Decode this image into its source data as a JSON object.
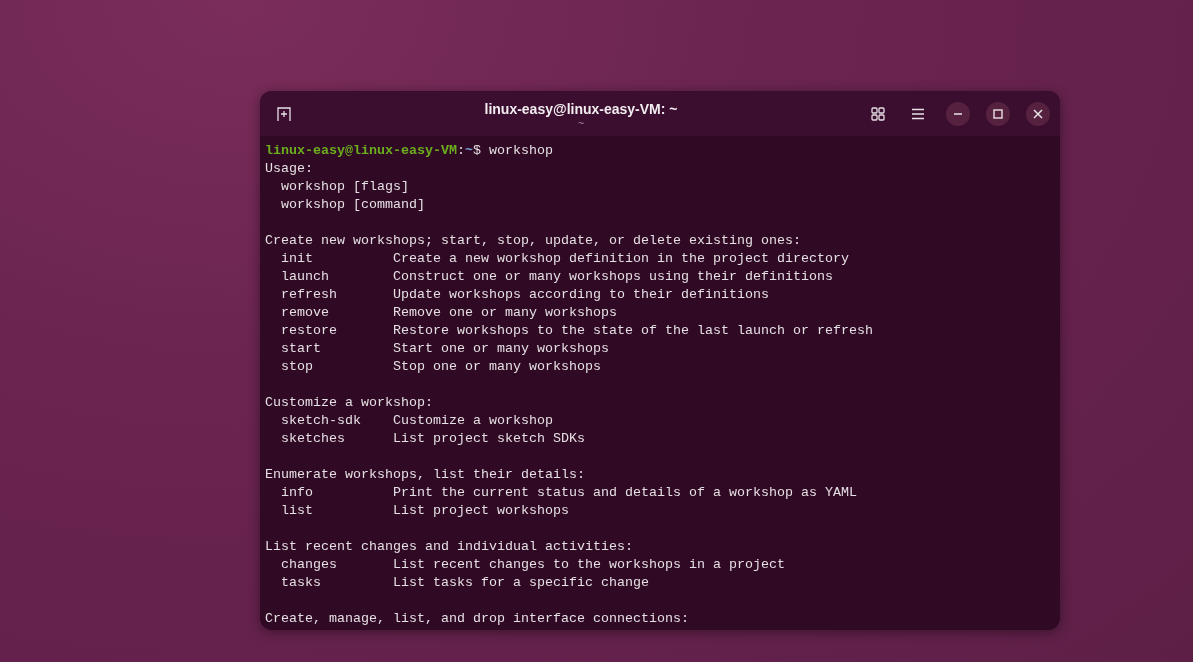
{
  "window": {
    "title": "linux-easy@linux-easy-VM: ~",
    "subtitle": "~"
  },
  "prompt": {
    "user_host": "linux-easy@linux-easy-VM",
    "separator": ":",
    "path": "~",
    "symbol": "$",
    "command": "workshop"
  },
  "usage": {
    "heading": "Usage:",
    "lines": [
      "workshop [flags]",
      "workshop [command]"
    ]
  },
  "sections": [
    {
      "heading": "Create new workshops; start, stop, update, or delete existing ones:",
      "commands": [
        {
          "name": "init",
          "description": "Create a new workshop definition in the project directory"
        },
        {
          "name": "launch",
          "description": "Construct one or many workshops using their definitions"
        },
        {
          "name": "refresh",
          "description": "Update workshops according to their definitions"
        },
        {
          "name": "remove",
          "description": "Remove one or many workshops"
        },
        {
          "name": "restore",
          "description": "Restore workshops to the state of the last launch or refresh"
        },
        {
          "name": "start",
          "description": "Start one or many workshops"
        },
        {
          "name": "stop",
          "description": "Stop one or many workshops"
        }
      ]
    },
    {
      "heading": "Customize a workshop:",
      "commands": [
        {
          "name": "sketch-sdk",
          "description": "Customize a workshop"
        },
        {
          "name": "sketches",
          "description": "List project sketch SDKs"
        }
      ]
    },
    {
      "heading": "Enumerate workshops, list their details:",
      "commands": [
        {
          "name": "info",
          "description": "Print the current status and details of a workshop as YAML"
        },
        {
          "name": "list",
          "description": "List project workshops"
        }
      ]
    },
    {
      "heading": "List recent changes and individual activities:",
      "commands": [
        {
          "name": "changes",
          "description": "List recent changes to the workshops in a project"
        },
        {
          "name": "tasks",
          "description": "List tasks for a specific change"
        }
      ]
    },
    {
      "heading": "Create, manage, list, and drop interface connections:"
    }
  ]
}
